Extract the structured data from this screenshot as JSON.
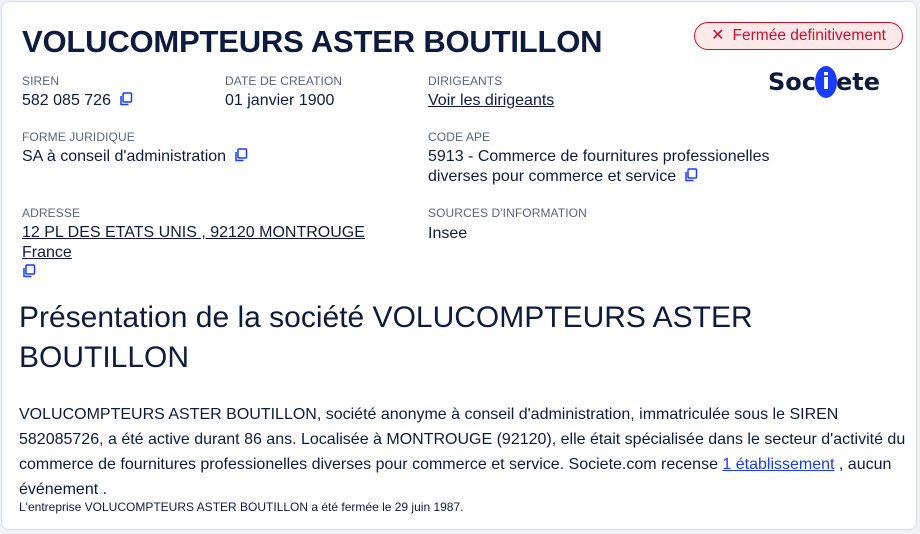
{
  "company": {
    "title": "VOLUCOMPTEURS ASTER BOUTILLON",
    "status": "Fermée definitivement"
  },
  "logo": {
    "left": "Soc",
    "middle": "i",
    "right": "ete"
  },
  "fields": {
    "siren": {
      "label": "SIREN",
      "value": "582 085 726"
    },
    "creation": {
      "label": "DATE DE CREATION",
      "value": "01 janvier 1900"
    },
    "dirigeants": {
      "label": "DIRIGEANTS",
      "value": "Voir les dirigeants"
    },
    "forme": {
      "label": "FORME JURIDIQUE",
      "value": "SA à conseil d'administration"
    },
    "ape": {
      "label": "CODE APE",
      "value_line1": "5913 - Commerce de fournitures professionelles",
      "value_line2": "diverses pour commerce et service"
    },
    "adresse": {
      "label": "ADRESSE",
      "value": "12 PL DES ETATS UNIS , 92120 MONTROUGE France"
    },
    "sources": {
      "label": "SOURCES D'INFORMATION",
      "value": "Insee"
    }
  },
  "presentation": {
    "title": "Présentation de la société VOLUCOMPTEURS ASTER BOUTILLON",
    "text_before": "VOLUCOMPTEURS ASTER BOUTILLON, société anonyme à conseil d'administration, immatriculée sous le SIREN 582085726, a été active durant 86 ans. Localisée à MONTROUGE (92120), elle était spécialisée dans le secteur d'activité du commerce de fournitures professionelles diverses pour commerce et service. Societe.com recense ",
    "link": "1 établissement",
    "text_after": " , aucun événement .",
    "closure": "L'entreprise VOLUCOMPTEURS ASTER BOUTILLON a été fermée le 29 juin 1987."
  },
  "colors": {
    "accent": "#1a3cff",
    "danger": "#c8102e",
    "text": "#0f1b3d"
  }
}
